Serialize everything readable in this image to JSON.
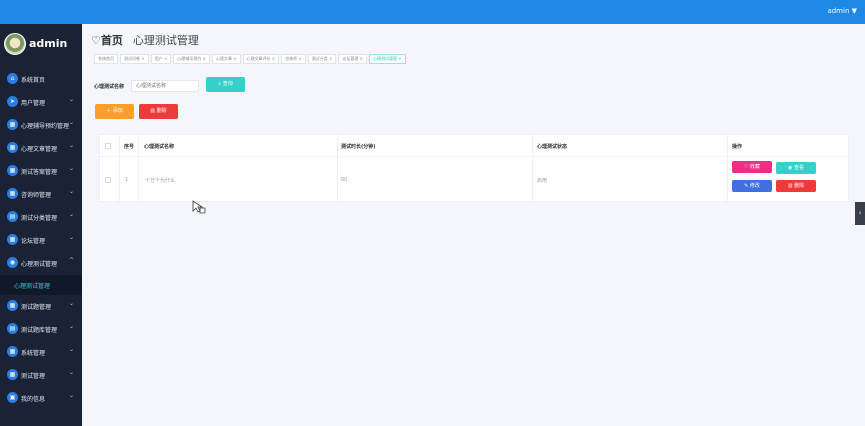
{
  "topbar": {
    "user": "admin ▼"
  },
  "brand": {
    "name": "admin"
  },
  "sidebar": {
    "items": [
      {
        "label": "系统首页",
        "icon": "home-icon",
        "glyph": "⌂",
        "chevron": ""
      },
      {
        "label": "用户管理",
        "icon": "send-icon",
        "glyph": "➤",
        "chevron": "⌄"
      },
      {
        "label": "心理辅导预约管理",
        "icon": "grid-icon",
        "glyph": "▦",
        "chevron": "⌄"
      },
      {
        "label": "心理文章管理",
        "icon": "grid-icon",
        "glyph": "▦",
        "chevron": "⌄"
      },
      {
        "label": "测试答案管理",
        "icon": "grid-icon",
        "glyph": "▦",
        "chevron": "⌄"
      },
      {
        "label": "咨询师管理",
        "icon": "grid-icon",
        "glyph": "▦",
        "chevron": "⌄"
      },
      {
        "label": "测试分类管理",
        "icon": "store-icon",
        "glyph": "▤",
        "chevron": "⌄"
      },
      {
        "label": "论坛管理",
        "icon": "grid-icon",
        "glyph": "▦",
        "chevron": "⌄"
      },
      {
        "label": "心理测试管理",
        "icon": "eye-icon",
        "glyph": "◉",
        "chevron": "^"
      }
    ],
    "subitem": "心理测试管理",
    "items_after": [
      {
        "label": "测试题管理",
        "icon": "grid-icon",
        "glyph": "▦",
        "chevron": "⌄"
      },
      {
        "label": "测试题库管理",
        "icon": "doc-icon",
        "glyph": "▤",
        "chevron": "⌄"
      },
      {
        "label": "系统管理",
        "icon": "grid-icon",
        "glyph": "▦",
        "chevron": "⌄"
      },
      {
        "label": "测试管理",
        "icon": "grid-icon",
        "glyph": "▦",
        "chevron": "⌄"
      },
      {
        "label": "我的信息",
        "icon": "user-card-icon",
        "glyph": "▣",
        "chevron": "⌄"
      }
    ]
  },
  "breadcrumb": {
    "home": "首页",
    "current": "心理测试管理"
  },
  "tags": [
    "系统首页",
    "测试问卷 ×",
    "用户 ×",
    "心理辅导预约 ×",
    "心理文章 ×",
    "心理文章评论 ×",
    "咨询师 ×",
    "测试分类 ×",
    "论坛管理 ×",
    "心理测试管理 ×"
  ],
  "search": {
    "label": "心理测试名称",
    "placeholder": "心理测试名称",
    "button": "查询"
  },
  "actions": {
    "add": "添加",
    "delete": "删除"
  },
  "table": {
    "columns": {
      "no": "序号",
      "name": "心理测试名称",
      "duration": "测试时长(分钟)",
      "status": "心理测试状态",
      "ops": "操作"
    },
    "rows": [
      {
        "no": "1",
        "name": "十万个为什么",
        "duration": "60",
        "status": "启用"
      }
    ],
    "row_buttons": {
      "favorite": "收藏",
      "view": "查看",
      "edit": "修改",
      "delete": "删除"
    }
  },
  "colors": {
    "topbar": "#1e88e5",
    "sidebar": "#1a2236",
    "accent": "#36cfc9",
    "add": "#fa9f2b",
    "danger": "#ee3a3a",
    "pink": "#ee2f83",
    "blue": "#3f6fe0"
  }
}
